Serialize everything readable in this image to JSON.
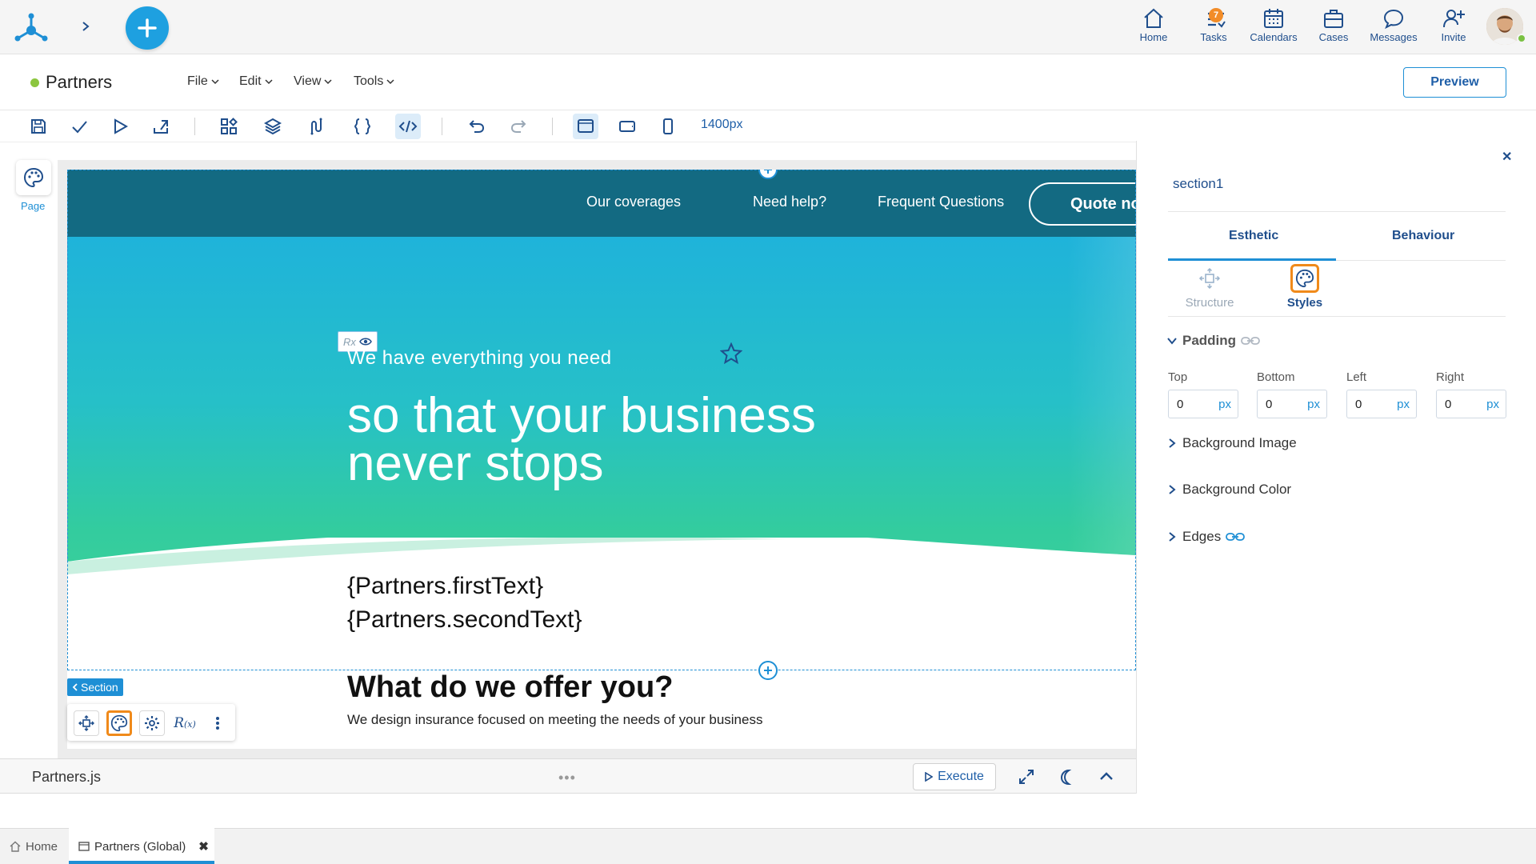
{
  "topbar": {
    "nav": [
      {
        "label": "Home",
        "icon": "home-icon"
      },
      {
        "label": "Tasks",
        "icon": "tasks-icon",
        "badge": "7"
      },
      {
        "label": "Calendars",
        "icon": "calendar-icon"
      },
      {
        "label": "Cases",
        "icon": "briefcase-icon"
      },
      {
        "label": "Messages",
        "icon": "chat-icon"
      },
      {
        "label": "Invite",
        "icon": "invite-user-icon"
      }
    ]
  },
  "document": {
    "title": "Partners",
    "menus": [
      "File",
      "Edit",
      "View",
      "Tools"
    ],
    "preview_label": "Preview",
    "width_label": "1400px"
  },
  "left_rail": {
    "page_label": "Page"
  },
  "site": {
    "nav_links": [
      "Our coverages",
      "Need help?",
      "Frequent Questions"
    ],
    "quote_button": "Quote no",
    "rx_chip": "Rx",
    "hero_kicker": "We have everything you need",
    "hero_title_line1": "so that your business",
    "hero_title_line2": "never stops",
    "first_text": "{Partners.firstText}",
    "second_text": "{Partners.secondText}",
    "offer_title": "What do we offer you?",
    "offer_text": "We design insurance focused on meeting the needs of your business"
  },
  "section_tag": "Section",
  "codebar": {
    "file": "Partners.js",
    "handle": "•••",
    "execute_label": "Execute"
  },
  "panel": {
    "title": "section1",
    "tabs": [
      "Esthetic",
      "Behaviour"
    ],
    "subtabs": [
      "Structure",
      "Styles"
    ],
    "padding_label": "Padding",
    "fields": [
      {
        "label": "Top",
        "value": "0",
        "unit": "px"
      },
      {
        "label": "Bottom",
        "value": "0",
        "unit": "px"
      },
      {
        "label": "Left",
        "value": "0",
        "unit": "px"
      },
      {
        "label": "Right",
        "value": "0",
        "unit": "px"
      }
    ],
    "sections": [
      "Background Image",
      "Background Color",
      "Edges"
    ]
  },
  "window_tabs": [
    {
      "label": "Home"
    },
    {
      "label": "Partners (Global)"
    }
  ],
  "colors": {
    "accent": "#1e8fd5",
    "navy": "#1f4e8c",
    "site_nav": "#136a82",
    "highlight": "#f08a1a",
    "status_green": "#8cc63f"
  }
}
